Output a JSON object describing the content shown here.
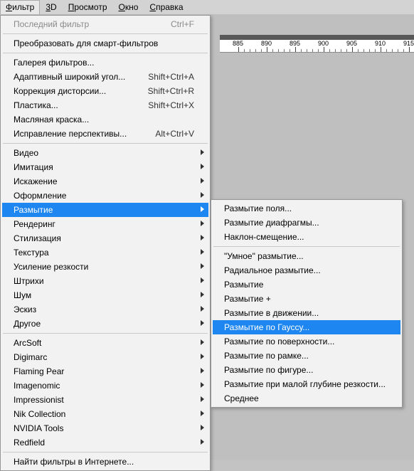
{
  "menubar": {
    "filter": {
      "prefix": "Ф",
      "rest": "ильтр"
    },
    "three_d": {
      "prefix": "3",
      "rest": "D"
    },
    "view": {
      "prefix": "П",
      "rest": "росмотр"
    },
    "window": {
      "prefix": "О",
      "rest": "кно"
    },
    "help": {
      "prefix": "С",
      "rest": "правка"
    }
  },
  "ruler": {
    "labels": [
      "885",
      "890",
      "895",
      "900",
      "905",
      "910",
      "915"
    ]
  },
  "filter_menu": {
    "last_filter": {
      "label": "Последний фильтр",
      "shortcut": "Ctrl+F"
    },
    "convert_smart": {
      "label": "Преобразовать для смарт-фильтров"
    },
    "filter_gallery": {
      "label": "Галерея фильтров..."
    },
    "adaptive_wide": {
      "label": "Адаптивный широкий угол...",
      "shortcut": "Shift+Ctrl+A"
    },
    "lens_correction": {
      "label": "Коррекция дисторсии...",
      "shortcut": "Shift+Ctrl+R"
    },
    "liquify": {
      "label": "Пластика...",
      "shortcut": "Shift+Ctrl+X"
    },
    "oil_paint": {
      "label": "Масляная краска..."
    },
    "vanishing_point": {
      "label": "Исправление перспективы...",
      "shortcut": "Alt+Ctrl+V"
    },
    "video": {
      "label": "Видео"
    },
    "artistic": {
      "label": "Имитация"
    },
    "distort": {
      "label": "Искажение"
    },
    "pixelate": {
      "label": "Оформление"
    },
    "blur": {
      "label": "Размытие"
    },
    "render": {
      "label": "Рендеринг"
    },
    "stylize": {
      "label": "Стилизация"
    },
    "texture": {
      "label": "Текстура"
    },
    "sharpen": {
      "label": "Усиление резкости"
    },
    "brush": {
      "label": "Штрихи"
    },
    "noise": {
      "label": "Шум"
    },
    "sketch": {
      "label": "Эскиз"
    },
    "other": {
      "label": "Другое"
    },
    "arcsoft": {
      "label": "ArcSoft"
    },
    "digimarc": {
      "label": "Digimarc"
    },
    "flaming_pear": {
      "label": "Flaming Pear"
    },
    "imagenomic": {
      "label": "Imagenomic"
    },
    "impressionist": {
      "label": "Impressionist"
    },
    "nik": {
      "label": "Nik Collection"
    },
    "nvidia": {
      "label": "NVIDIA Tools"
    },
    "redfield": {
      "label": "Redfield"
    },
    "browse_online": {
      "label": "Найти фильтры в Интернете..."
    }
  },
  "blur_submenu": {
    "field": {
      "label": "Размытие поля..."
    },
    "iris": {
      "label": "Размытие диафрагмы..."
    },
    "tilt": {
      "label": "Наклон-смещение..."
    },
    "smart": {
      "label": "\"Умное\" размытие..."
    },
    "radial": {
      "label": "Радиальное размытие..."
    },
    "blur": {
      "label": "Размытие"
    },
    "blur_more": {
      "label": "Размытие +"
    },
    "motion": {
      "label": "Размытие в движении..."
    },
    "gaussian": {
      "label": "Размытие по Гауссу..."
    },
    "surface": {
      "label": "Размытие по поверхности..."
    },
    "box": {
      "label": "Размытие по рамке..."
    },
    "shape": {
      "label": "Размытие по фигуре..."
    },
    "lens": {
      "label": "Размытие при малой глубине резкости..."
    },
    "average": {
      "label": "Среднее"
    }
  }
}
